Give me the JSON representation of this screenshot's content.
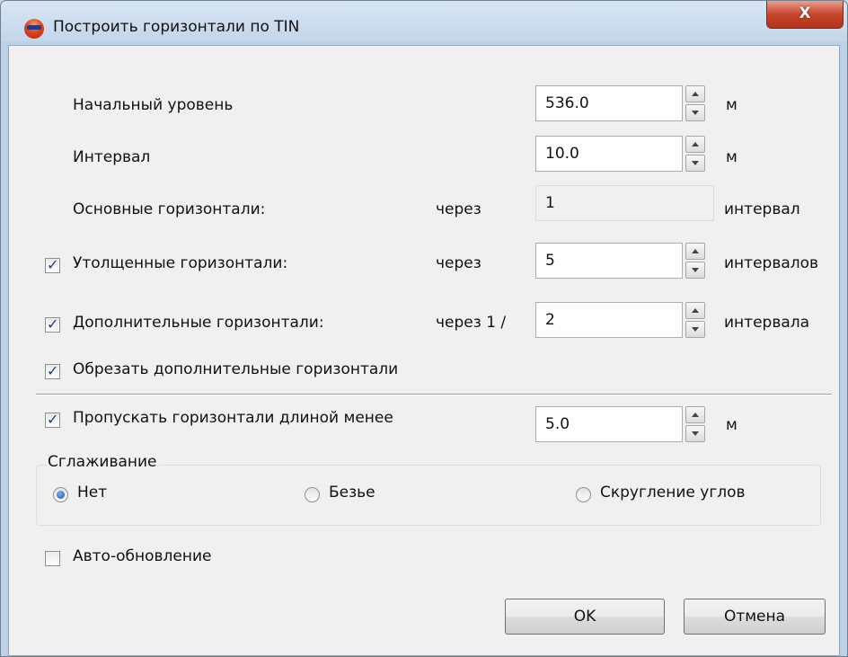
{
  "window": {
    "title": "Построить горизонтали по TIN",
    "close_label": "X"
  },
  "fields": {
    "start_level": {
      "label": "Начальный уровень",
      "value": "536.0",
      "unit": "м"
    },
    "interval": {
      "label": "Интервал",
      "value": "10.0",
      "unit": "м"
    },
    "main_contours": {
      "label": "Основные горизонтали:",
      "prefix": "через",
      "value": "1",
      "unit": "интервал"
    },
    "thick_contours": {
      "label": "Утолщенные горизонтали:",
      "checked": true,
      "prefix": "через",
      "value": "5",
      "unit": "интервалов"
    },
    "extra_contours": {
      "label": "Дополнительные горизонтали:",
      "checked": true,
      "prefix": "через 1 /",
      "value": "2",
      "unit": "интервала"
    },
    "trim_extra": {
      "label": "Обрезать дополнительные горизонтали",
      "checked": true
    },
    "skip_short": {
      "label": "Пропускать горизонтали длиной менее",
      "checked": true,
      "value": "5.0",
      "unit": "м"
    }
  },
  "smoothing": {
    "title": "Сглаживание",
    "options": [
      {
        "label": "Нет",
        "selected": true
      },
      {
        "label": "Безье",
        "selected": false
      },
      {
        "label": "Скругление углов",
        "selected": false
      }
    ]
  },
  "auto_update": {
    "label": "Авто-обновление",
    "checked": false
  },
  "buttons": {
    "ok": "OK",
    "cancel": "Отмена"
  }
}
